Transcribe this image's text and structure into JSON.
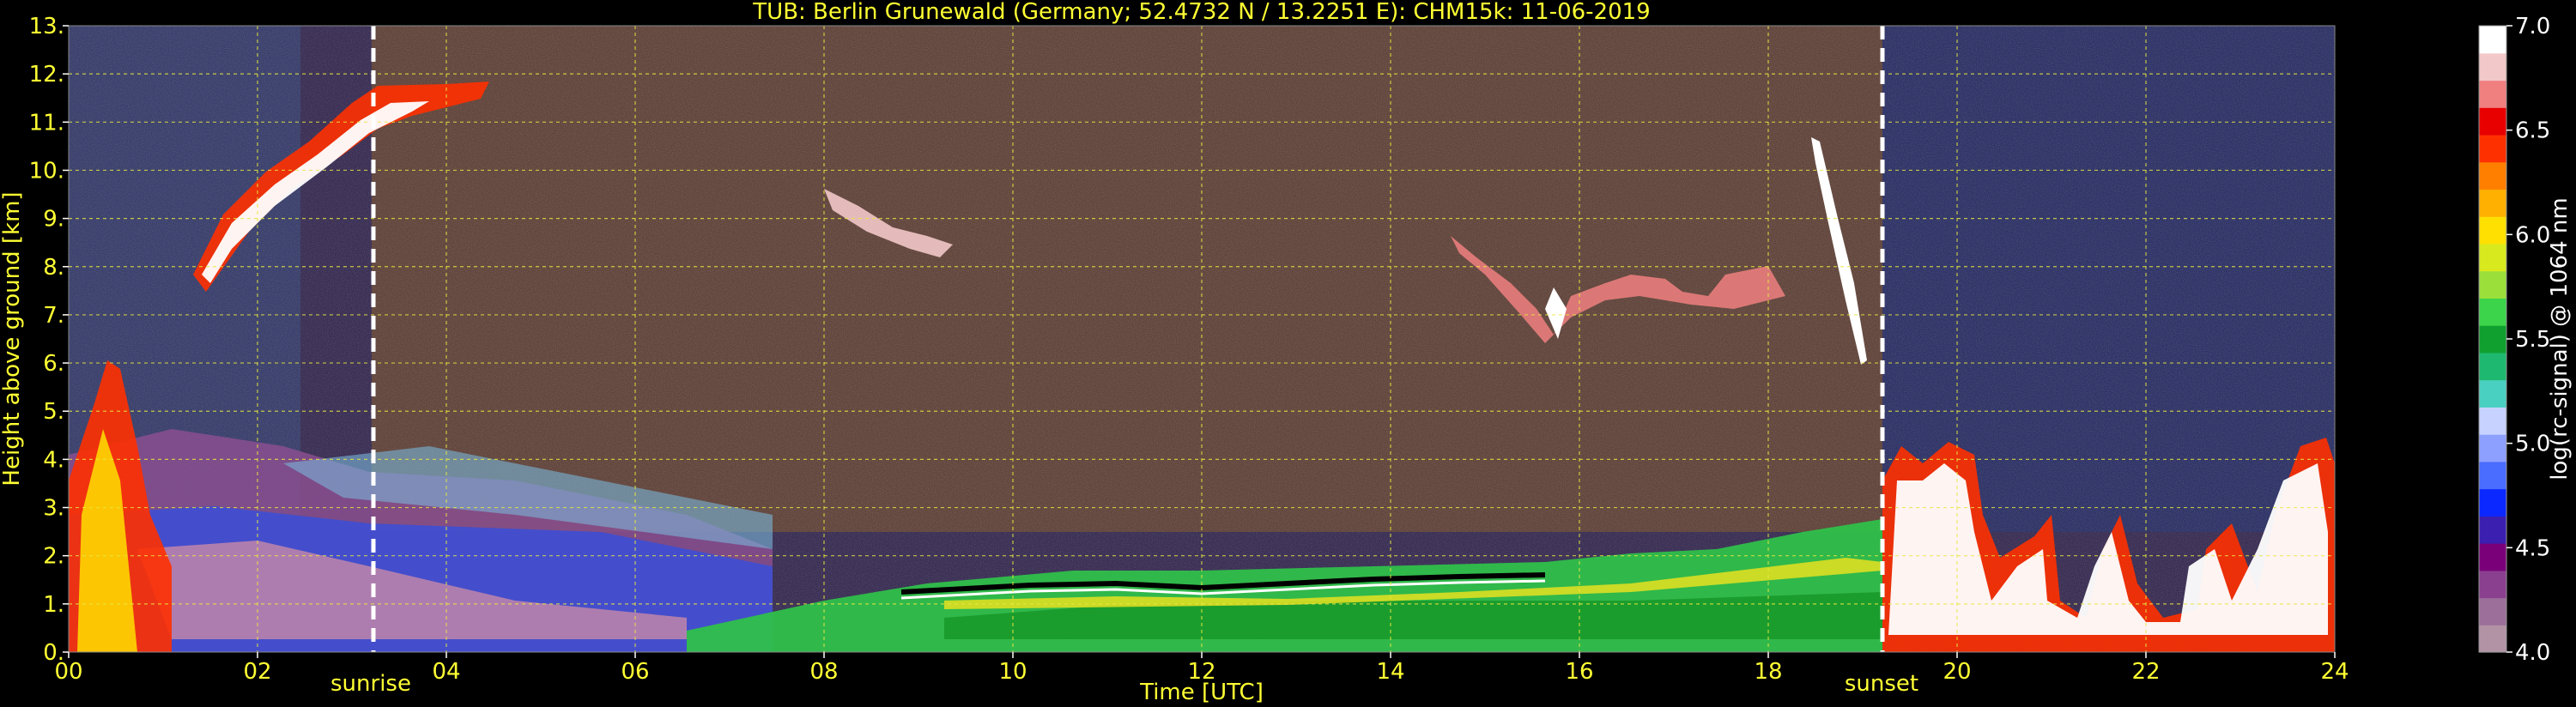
{
  "chart_data": {
    "type": "heatmap",
    "title": "TUB: Berlin Grunewald (Germany; 52.4732 N / 13.2251 E):    CHM15k: 11-06-2019",
    "xlabel": "Time [UTC]",
    "ylabel": "Height above ground [km]",
    "xlim": [
      0,
      24
    ],
    "ylim": [
      0,
      13
    ],
    "x_ticks": [
      "00",
      "02",
      "04",
      "06",
      "08",
      "10",
      "12",
      "14",
      "16",
      "18",
      "20",
      "22",
      "24"
    ],
    "y_ticks": [
      "0.",
      "1.",
      "2.",
      "3.",
      "4.",
      "5.",
      "6.",
      "7.",
      "8.",
      "9.",
      "10.",
      "11.",
      "12.",
      "13."
    ],
    "grid": true,
    "annotations": [
      {
        "label": "sunrise",
        "x": 3.2
      },
      {
        "label": "sunset",
        "x": 19.2
      }
    ],
    "colorbar": {
      "label": "log(rc-signal) @ 1064 nm",
      "range": [
        4.0,
        7.0
      ],
      "ticks": [
        "4.0",
        "4.5",
        "5.0",
        "5.5",
        "6.0",
        "6.5",
        "7.0"
      ],
      "colors": [
        "#b293a6",
        "#9b6f99",
        "#8a3f8f",
        "#7a007a",
        "#3b1fb0",
        "#0a28ff",
        "#4a6cff",
        "#8ea0ff",
        "#c8d2ff",
        "#4ad0c0",
        "#1fb870",
        "#10a030",
        "#3cd44a",
        "#9be03a",
        "#d8ea1e",
        "#ffe000",
        "#ffb000",
        "#ff7f00",
        "#ff3000",
        "#e80000",
        "#f08080",
        "#f2c8c8",
        "#ffffff"
      ]
    },
    "features": [
      {
        "type": "boundary_layer_top",
        "x": [
          7.0,
          8.0,
          9.0,
          10.0,
          11.0,
          12.0,
          13.0,
          14.0,
          14.6,
          16.0,
          17.0,
          18.0,
          19.2
        ],
        "y": [
          0.8,
          1.0,
          1.2,
          1.4,
          1.3,
          1.4,
          1.5,
          1.5,
          1.6,
          1.7,
          1.9,
          2.1,
          2.3
        ]
      },
      {
        "type": "cirrus_layer",
        "x": [
          1.3,
          1.8,
          2.3,
          2.8,
          3.2,
          3.8,
          4.5
        ],
        "y": [
          7.8,
          9.5,
          10.7,
          11.4,
          11.8,
          11.6,
          11.9
        ]
      },
      {
        "type": "mid_cloud",
        "x": [
          7.9,
          8.4,
          9.0,
          9.4
        ],
        "y": [
          9.0,
          8.5,
          8.3,
          8.0
        ]
      },
      {
        "type": "mid_cloud",
        "x": [
          14.8,
          15.5,
          16.3,
          17.2,
          18.1,
          18.9
        ],
        "y": [
          8.0,
          6.8,
          7.8,
          7.4,
          7.6,
          6.4
        ]
      }
    ]
  }
}
